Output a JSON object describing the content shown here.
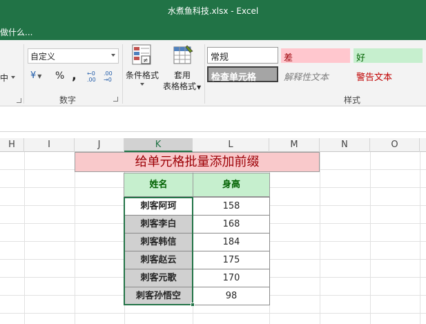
{
  "window": {
    "title": "水煮鱼科技.xlsx - Excel"
  },
  "tell_me": {
    "text": "做什么..."
  },
  "ribbon": {
    "alignment": {
      "center_label": "中"
    },
    "number": {
      "format_value": "自定义",
      "currency_symbol": "¥",
      "percent_symbol": "%",
      "comma_symbol": ",",
      "increase_decimal": "←0 .00",
      "decrease_decimal": ".00 →0",
      "group_label": "数字"
    },
    "styles": {
      "conditional_format_label": "条件格式",
      "table_format_label_1": "套用",
      "table_format_label_2": "表格格式",
      "normal": "常规",
      "bad": "差",
      "good": "好",
      "check_cell": "检查单元格",
      "explanatory": "解释性文本",
      "warning": "警告文本",
      "group_label": "样式"
    }
  },
  "columns": [
    "H",
    "I",
    "J",
    "K",
    "L",
    "M",
    "N",
    "O"
  ],
  "sheet": {
    "banner": "给单元格批量添加前缀",
    "headers": {
      "name": "姓名",
      "height": "身高"
    },
    "rows": [
      {
        "name": "刺客阿珂",
        "height": "158"
      },
      {
        "name": "刺客李白",
        "height": "168"
      },
      {
        "name": "刺客韩信",
        "height": "184"
      },
      {
        "name": "刺客赵云",
        "height": "175"
      },
      {
        "name": "刺客元歌",
        "height": "170"
      },
      {
        "name": "刺客孙悟空",
        "height": "98"
      }
    ]
  },
  "colors": {
    "accent": "#217346",
    "bad_bg": "#ffc7ce",
    "good_bg": "#c6efce",
    "warning_text": "#c00000"
  }
}
